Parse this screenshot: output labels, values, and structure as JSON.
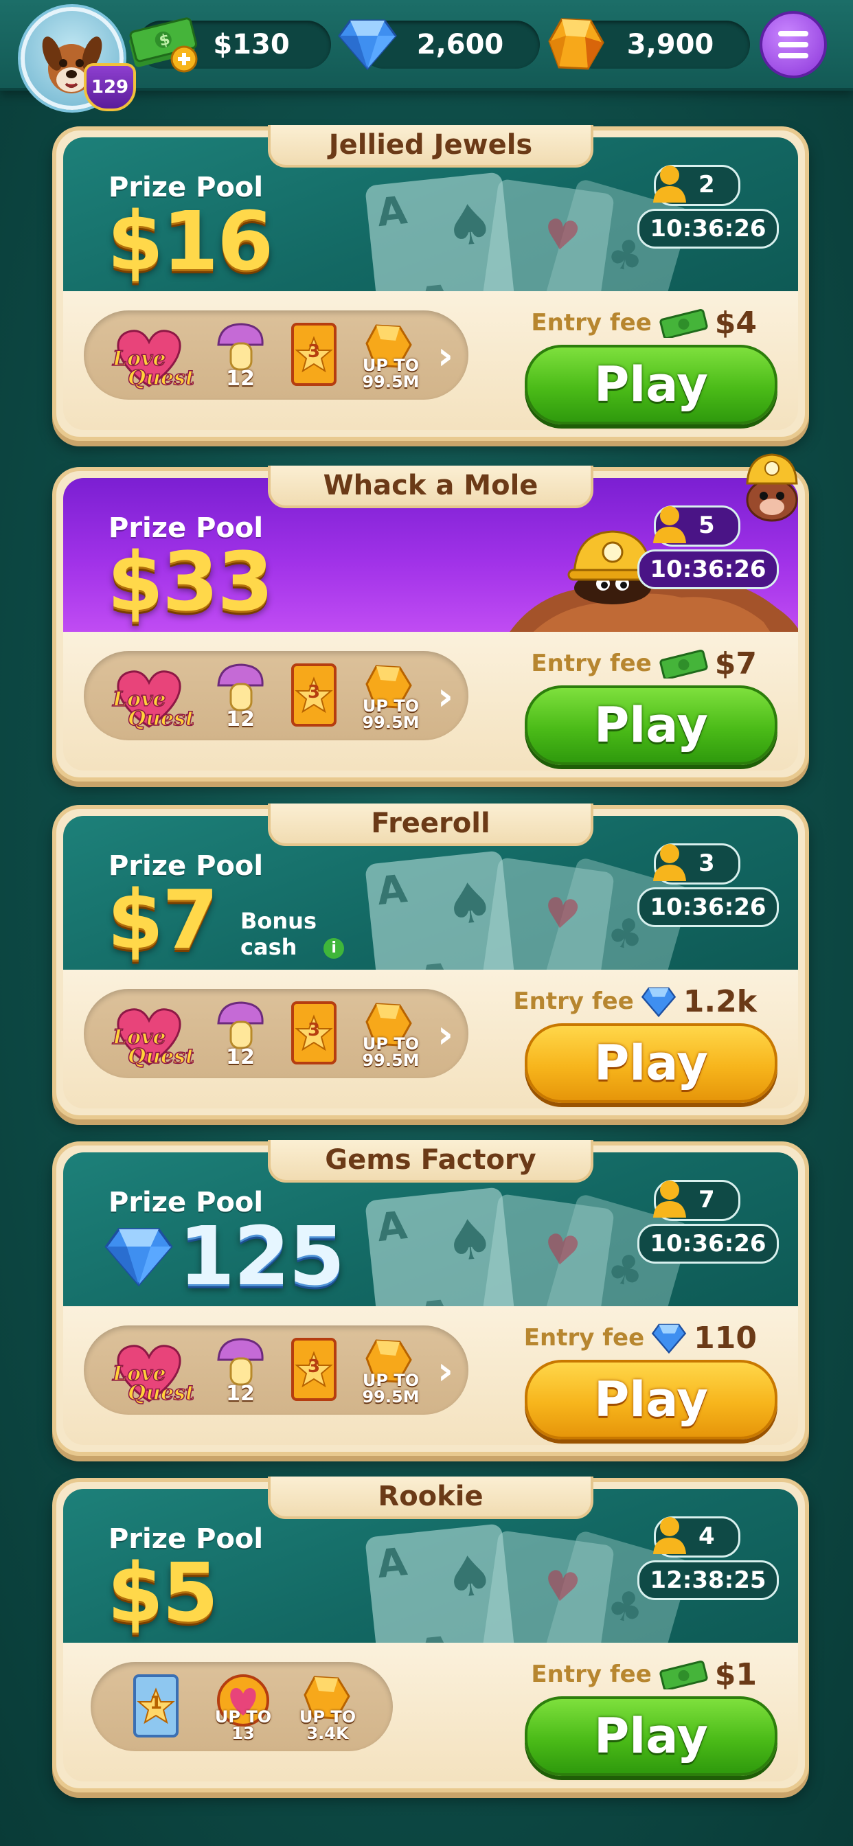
{
  "header": {
    "level": "129",
    "cash": "$130",
    "gems": "2,600",
    "coins": "3,900",
    "icons": {
      "cash": "cash-stack-plus-icon",
      "gems": "blue-gem-icon",
      "coins": "gold-nugget-icon",
      "menu": "hamburger-menu-icon"
    }
  },
  "colors": {
    "play_green": "#4bbb18",
    "play_gold": "#f7b51c",
    "teal": "#136863",
    "purple": "#a132e8",
    "title_brown": "#6b3a17"
  },
  "cards": [
    {
      "title": "Jellied Jewels",
      "prize_label": "Prize Pool",
      "prize": "$16",
      "players": "2",
      "timer": "10:36:26",
      "rewards": [
        {
          "name": "Love Quest"
        },
        {
          "label": "12"
        },
        {
          "label": "3"
        },
        {
          "label": "UP TO 99.5M"
        }
      ],
      "entry_label": "Entry fee",
      "entry_fee": "$4",
      "entry_currency": "cash",
      "play": "Play",
      "button": "green"
    },
    {
      "title": "Whack a Mole",
      "prize_label": "Prize Pool",
      "prize": "$33",
      "players": "5",
      "timer": "10:36:26",
      "rewards": [
        {
          "name": "Love Quest"
        },
        {
          "label": "12"
        },
        {
          "label": "3"
        },
        {
          "label": "UP TO 99.5M"
        }
      ],
      "entry_label": "Entry fee",
      "entry_fee": "$7",
      "entry_currency": "cash",
      "play": "Play",
      "button": "green"
    },
    {
      "title": "Freeroll",
      "prize_label": "Prize Pool",
      "prize": "$7",
      "bonus": "Bonus cash",
      "players": "3",
      "timer": "10:36:26",
      "rewards": [
        {
          "name": "Love Quest"
        },
        {
          "label": "12"
        },
        {
          "label": "3"
        },
        {
          "label": "UP TO 99.5M"
        }
      ],
      "entry_label": "Entry fee",
      "entry_fee": "1.2k",
      "entry_currency": "gem",
      "play": "Play",
      "button": "gold"
    },
    {
      "title": "Gems Factory",
      "prize_label": "Prize Pool",
      "prize": "125",
      "prize_currency": "gem",
      "players": "7",
      "timer": "10:36:26",
      "rewards": [
        {
          "name": "Love Quest"
        },
        {
          "label": "12"
        },
        {
          "label": "3"
        },
        {
          "label": "UP TO 99.5M"
        }
      ],
      "entry_label": "Entry fee",
      "entry_fee": "110",
      "entry_currency": "gem",
      "play": "Play",
      "button": "gold"
    },
    {
      "title": "Rookie",
      "prize_label": "Prize Pool",
      "prize": "$5",
      "players": "4",
      "timer": "12:38:25",
      "rewards": [
        {
          "label": "1"
        },
        {
          "label": "UP TO 13"
        },
        {
          "label": "UP TO 3.4K"
        }
      ],
      "entry_label": "Entry fee",
      "entry_fee": "$1",
      "entry_currency": "cash",
      "play": "Play",
      "button": "green"
    }
  ]
}
